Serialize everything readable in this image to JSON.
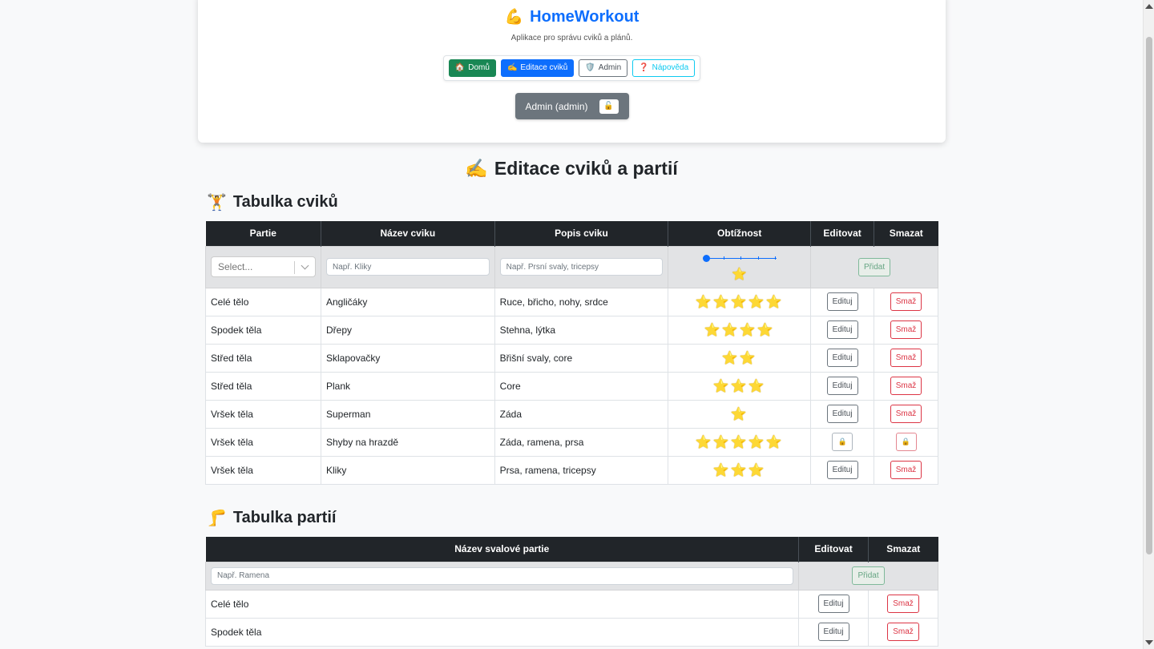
{
  "header": {
    "brand_icon": "💪",
    "brand": "HomeWorkout",
    "subtitle": "Aplikace pro správu cviků a plánů.",
    "nav": [
      {
        "icon": "🏠",
        "label": "Domů"
      },
      {
        "icon": "✍️",
        "label": "Editace cviků"
      },
      {
        "icon": "🛡️",
        "label": "Admin"
      },
      {
        "icon": "❓",
        "label": "Nápověda"
      }
    ],
    "user_label": "Admin (admin)",
    "logout_icon": "🔓"
  },
  "page": {
    "title_icon": "✍️",
    "title": "Editace cviků a partií"
  },
  "exercises": {
    "title_icon": "🏋️",
    "title": "Tabulka cviků",
    "columns": [
      "Partie",
      "Název cviku",
      "Popis cviku",
      "Obtížnost",
      "Editovat",
      "Smazat"
    ],
    "new_row": {
      "select_placeholder": "Select...",
      "name_placeholder": "Např. Kliky",
      "desc_placeholder": "Např. Prsní svaly, tricepsy",
      "difficulty": 1,
      "difficulty_stars": "⭐",
      "add_label": "Přidat"
    },
    "edit_label": "Edituj",
    "delete_label": "Smaž",
    "lock_icon": "🔒",
    "rows": [
      {
        "part": "Celé tělo",
        "name": "Angličáky",
        "desc": "Ruce, břicho, nohy, srdce",
        "difficulty": 5,
        "stars": "⭐⭐⭐⭐⭐",
        "locked": false
      },
      {
        "part": "Spodek těla",
        "name": "Dřepy",
        "desc": "Stehna, lýtka",
        "difficulty": 4,
        "stars": "⭐⭐⭐⭐",
        "locked": false
      },
      {
        "part": "Střed těla",
        "name": "Sklapovačky",
        "desc": "Břišní svaly, core",
        "difficulty": 2,
        "stars": "⭐⭐",
        "locked": false
      },
      {
        "part": "Střed těla",
        "name": "Plank",
        "desc": "Core",
        "difficulty": 3,
        "stars": "⭐⭐⭐",
        "locked": false
      },
      {
        "part": "Vršek těla",
        "name": "Superman",
        "desc": "Záda",
        "difficulty": 1,
        "stars": "⭐",
        "locked": false
      },
      {
        "part": "Vršek těla",
        "name": "Shyby na hrazdě",
        "desc": "Záda, ramena, prsa",
        "difficulty": 5,
        "stars": "⭐⭐⭐⭐⭐",
        "locked": true
      },
      {
        "part": "Vršek těla",
        "name": "Kliky",
        "desc": "Prsa, ramena, tricepsy",
        "difficulty": 3,
        "stars": "⭐⭐⭐",
        "locked": false
      }
    ]
  },
  "parts": {
    "title_icon": "🦵",
    "title": "Tabulka partií",
    "columns": [
      "Název svalové partie",
      "Editovat",
      "Smazat"
    ],
    "name_placeholder": "Např. Ramena",
    "add_label": "Přidat",
    "edit_label": "Edituj",
    "delete_label": "Smaž",
    "rows": [
      {
        "name": "Celé tělo"
      },
      {
        "name": "Spodek těla"
      }
    ]
  }
}
